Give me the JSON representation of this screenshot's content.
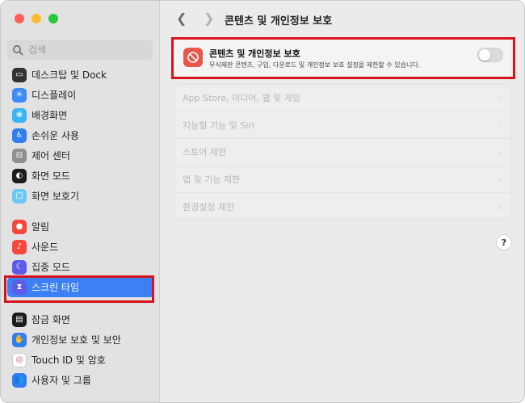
{
  "window": {
    "traffic_lights": [
      {
        "name": "close",
        "color": "#fe5f57"
      },
      {
        "name": "minimize",
        "color": "#febc2e"
      },
      {
        "name": "zoom",
        "color": "#28c840"
      }
    ]
  },
  "search": {
    "placeholder": "검색"
  },
  "sidebar": {
    "group1": [
      {
        "label": "데스크탑 및 Dock",
        "icon": "dock-icon",
        "color": "#333333"
      },
      {
        "label": "디스플레이",
        "icon": "display-icon",
        "color": "#3d8bf5"
      },
      {
        "label": "배경화면",
        "icon": "wallpaper-icon",
        "color": "#39b5f5"
      },
      {
        "label": "손쉬운 사용",
        "icon": "accessibility-icon",
        "color": "#2f7ff3"
      },
      {
        "label": "제어 센터",
        "icon": "control-center-icon",
        "color": "#8e8e93"
      },
      {
        "label": "화면 모드",
        "icon": "appearance-icon",
        "color": "#1c1c1e"
      },
      {
        "label": "화면 보호기",
        "icon": "screensaver-icon",
        "color": "#6cc8f5"
      }
    ],
    "group2": [
      {
        "label": "알림",
        "icon": "notifications-icon",
        "color": "#f5473b"
      },
      {
        "label": "사운드",
        "icon": "sound-icon",
        "color": "#f5473b"
      },
      {
        "label": "집중 모드",
        "icon": "focus-icon",
        "color": "#5e5ce6"
      },
      {
        "label": "스크린 타임",
        "icon": "hourglass-icon",
        "color": "#5e5ce6",
        "active": true
      }
    ],
    "group3": [
      {
        "label": "잠금 화면",
        "icon": "lock-screen-icon",
        "color": "#1c1c1e"
      },
      {
        "label": "개인정보 보호 및 보안",
        "icon": "hand-icon",
        "color": "#2f7ff3"
      },
      {
        "label": "Touch ID 및 암호",
        "icon": "fingerprint-icon",
        "color": "#ffffff"
      },
      {
        "label": "사용자 및 그룹",
        "icon": "users-icon",
        "color": "#2f7ff3"
      }
    ]
  },
  "header": {
    "title": "콘텐츠 및 개인정보 보호"
  },
  "feature": {
    "title": "콘텐츠 및 개인정보 보호",
    "description": "무식제판 콘텐츠, 구입, 다운로드 및 개인정보 보호 설정을 제한할 수 있습니다.",
    "enabled": false,
    "icon_color": "#e8574a"
  },
  "settings_rows": [
    {
      "label": "App Store, 미디어, 웹 및 게임"
    },
    {
      "label": "지능형 기능 및 Siri"
    },
    {
      "label": "스토어 제한"
    },
    {
      "label": "앱 및 기능 제한"
    },
    {
      "label": "환경설정 제한"
    }
  ],
  "help": {
    "label": "?"
  }
}
